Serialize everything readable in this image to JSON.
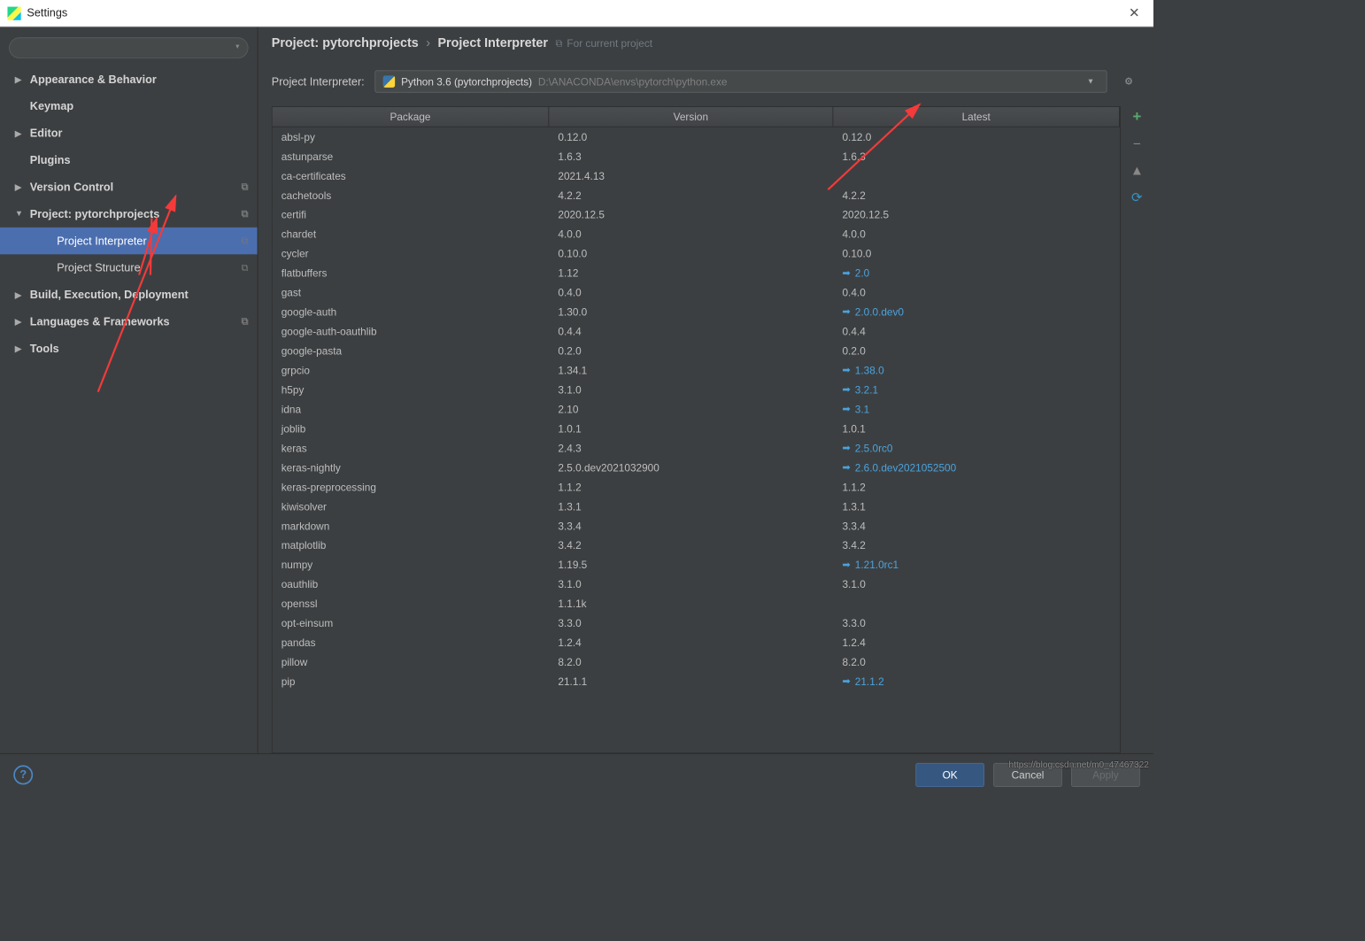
{
  "window": {
    "title": "Settings"
  },
  "sidebar": {
    "items": [
      {
        "label": "Appearance & Behavior",
        "expandable": true,
        "expanded": false,
        "bold": true
      },
      {
        "label": "Keymap",
        "expandable": false,
        "bold": true
      },
      {
        "label": "Editor",
        "expandable": true,
        "expanded": false,
        "bold": true
      },
      {
        "label": "Plugins",
        "expandable": false,
        "bold": true
      },
      {
        "label": "Version Control",
        "expandable": true,
        "expanded": false,
        "bold": true,
        "right_icon": true
      },
      {
        "label": "Project: pytorchprojects",
        "expandable": true,
        "expanded": true,
        "bold": true,
        "right_icon": true
      },
      {
        "label": "Project Interpreter",
        "sub": true,
        "selected": true,
        "right_icon": true
      },
      {
        "label": "Project Structure",
        "sub": true,
        "right_icon": true
      },
      {
        "label": "Build, Execution, Deployment",
        "expandable": true,
        "expanded": false,
        "bold": true
      },
      {
        "label": "Languages & Frameworks",
        "expandable": true,
        "expanded": false,
        "bold": true,
        "right_icon": true
      },
      {
        "label": "Tools",
        "expandable": true,
        "expanded": false,
        "bold": true
      }
    ]
  },
  "breadcrumb": {
    "part1": "Project: pytorchprojects",
    "part2": "Project Interpreter",
    "badge_text": "For current project"
  },
  "interpreter": {
    "label": "Project Interpreter:",
    "name": "Python 3.6 (pytorchprojects)",
    "path": "D:\\ANACONDA\\envs\\pytorch\\python.exe"
  },
  "table": {
    "headers": {
      "package": "Package",
      "version": "Version",
      "latest": "Latest"
    },
    "rows": [
      {
        "package": "absl-py",
        "version": "0.12.0",
        "latest": "0.12.0",
        "update": false
      },
      {
        "package": "astunparse",
        "version": "1.6.3",
        "latest": "1.6.3",
        "update": false
      },
      {
        "package": "ca-certificates",
        "version": "2021.4.13",
        "latest": "",
        "update": false
      },
      {
        "package": "cachetools",
        "version": "4.2.2",
        "latest": "4.2.2",
        "update": false
      },
      {
        "package": "certifi",
        "version": "2020.12.5",
        "latest": "2020.12.5",
        "update": false
      },
      {
        "package": "chardet",
        "version": "4.0.0",
        "latest": "4.0.0",
        "update": false
      },
      {
        "package": "cycler",
        "version": "0.10.0",
        "latest": "0.10.0",
        "update": false
      },
      {
        "package": "flatbuffers",
        "version": "1.12",
        "latest": "2.0",
        "update": true
      },
      {
        "package": "gast",
        "version": "0.4.0",
        "latest": "0.4.0",
        "update": false
      },
      {
        "package": "google-auth",
        "version": "1.30.0",
        "latest": "2.0.0.dev0",
        "update": true
      },
      {
        "package": "google-auth-oauthlib",
        "version": "0.4.4",
        "latest": "0.4.4",
        "update": false
      },
      {
        "package": "google-pasta",
        "version": "0.2.0",
        "latest": "0.2.0",
        "update": false
      },
      {
        "package": "grpcio",
        "version": "1.34.1",
        "latest": "1.38.0",
        "update": true
      },
      {
        "package": "h5py",
        "version": "3.1.0",
        "latest": "3.2.1",
        "update": true
      },
      {
        "package": "idna",
        "version": "2.10",
        "latest": "3.1",
        "update": true
      },
      {
        "package": "joblib",
        "version": "1.0.1",
        "latest": "1.0.1",
        "update": false
      },
      {
        "package": "keras",
        "version": "2.4.3",
        "latest": "2.5.0rc0",
        "update": true
      },
      {
        "package": "keras-nightly",
        "version": "2.5.0.dev2021032900",
        "latest": "2.6.0.dev2021052500",
        "update": true
      },
      {
        "package": "keras-preprocessing",
        "version": "1.1.2",
        "latest": "1.1.2",
        "update": false
      },
      {
        "package": "kiwisolver",
        "version": "1.3.1",
        "latest": "1.3.1",
        "update": false
      },
      {
        "package": "markdown",
        "version": "3.3.4",
        "latest": "3.3.4",
        "update": false
      },
      {
        "package": "matplotlib",
        "version": "3.4.2",
        "latest": "3.4.2",
        "update": false
      },
      {
        "package": "numpy",
        "version": "1.19.5",
        "latest": "1.21.0rc1",
        "update": true
      },
      {
        "package": "oauthlib",
        "version": "3.1.0",
        "latest": "3.1.0",
        "update": false
      },
      {
        "package": "openssl",
        "version": "1.1.1k",
        "latest": "",
        "update": false
      },
      {
        "package": "opt-einsum",
        "version": "3.3.0",
        "latest": "3.3.0",
        "update": false
      },
      {
        "package": "pandas",
        "version": "1.2.4",
        "latest": "1.2.4",
        "update": false
      },
      {
        "package": "pillow",
        "version": "8.2.0",
        "latest": "8.2.0",
        "update": false
      },
      {
        "package": "pip",
        "version": "21.1.1",
        "latest": "21.1.2",
        "update": true
      }
    ]
  },
  "footer": {
    "ok": "OK",
    "cancel": "Cancel",
    "apply": "Apply"
  },
  "watermark": "https://blog.csdn.net/m0_47467322"
}
